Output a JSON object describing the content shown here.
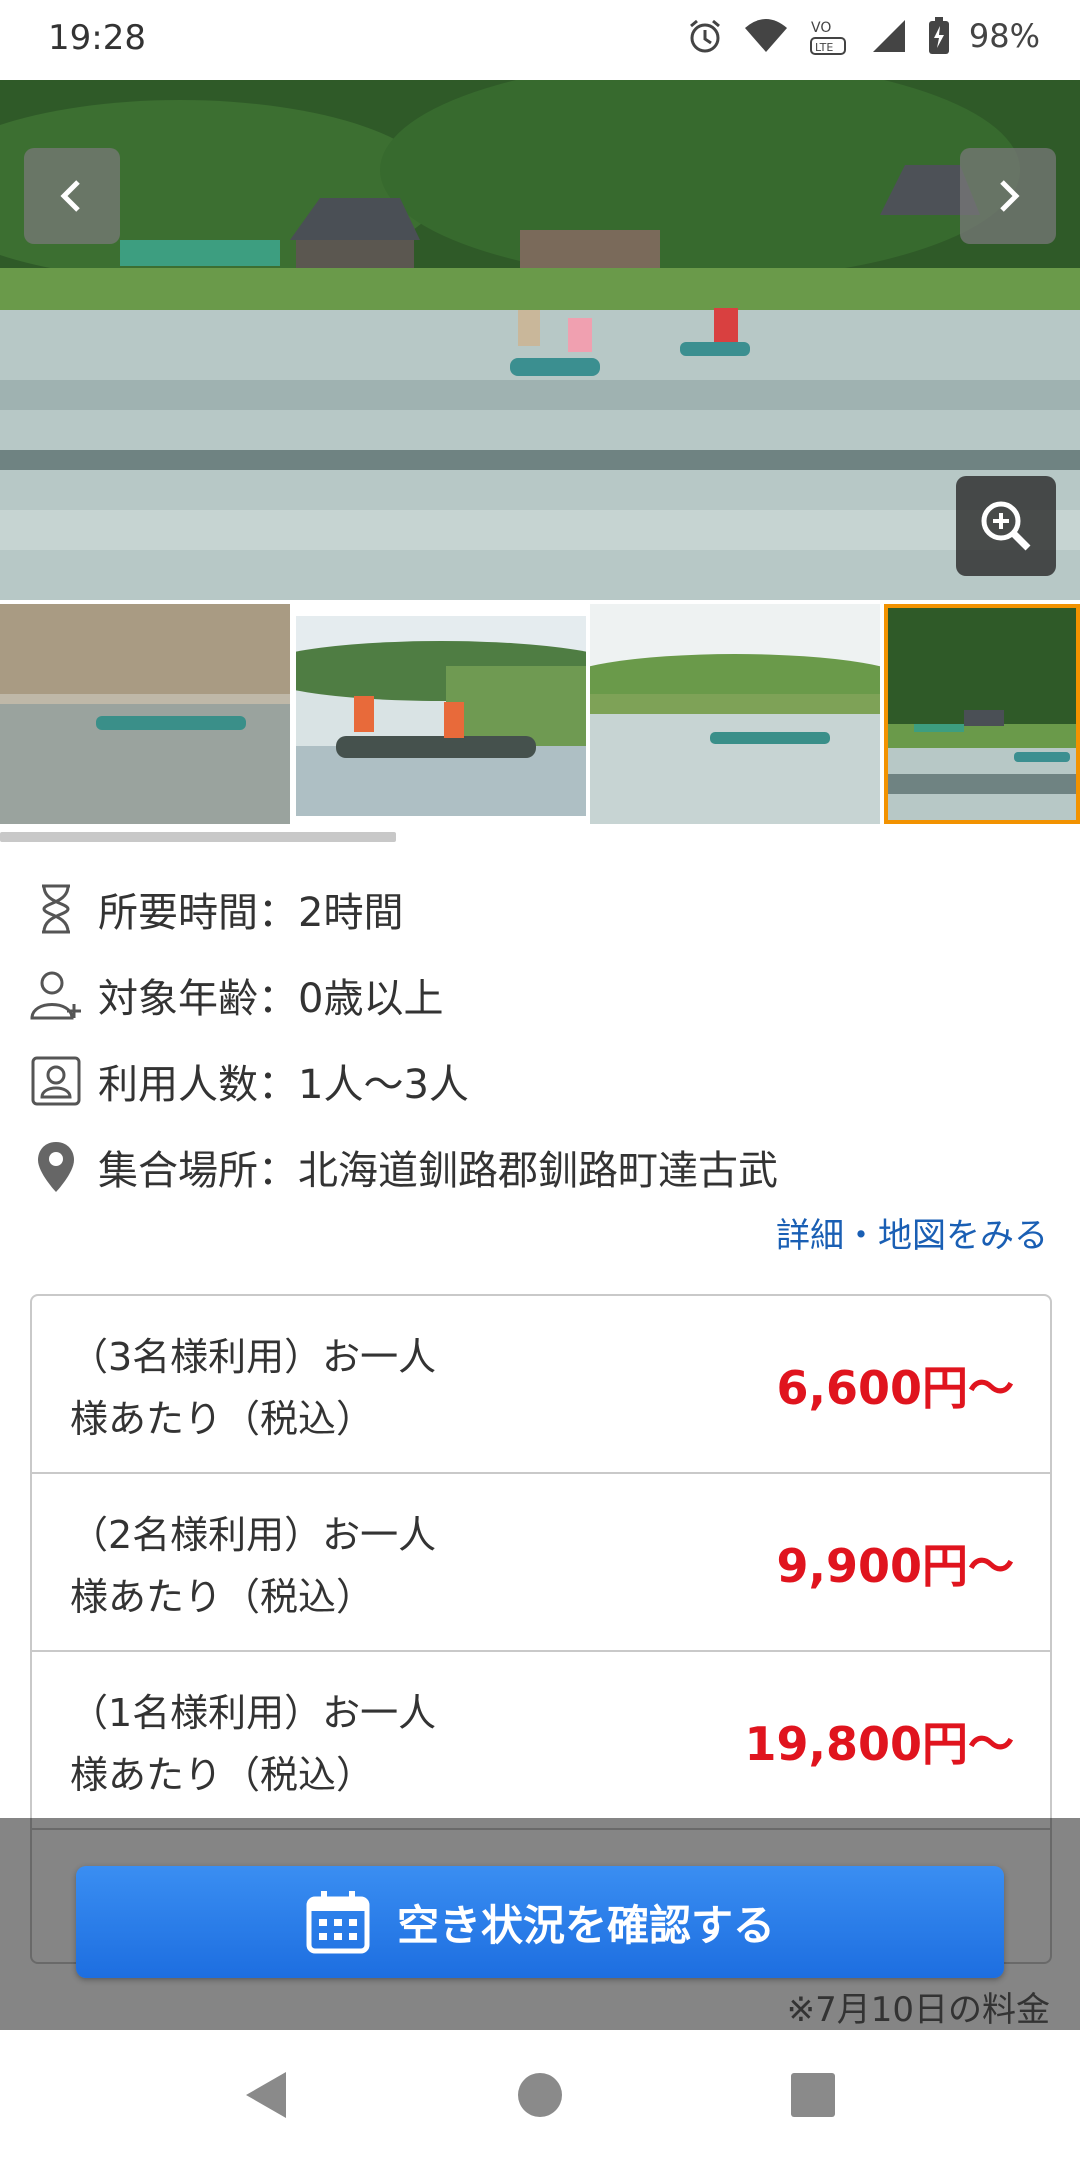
{
  "status_bar": {
    "time": "19:28",
    "battery_percent": "98%",
    "icons": [
      "alarm-icon",
      "wifi-icon",
      "volte-icon",
      "signal-icon",
      "battery-icon"
    ]
  },
  "gallery": {
    "thumbnails": [
      {
        "name": "thumbnail-1"
      },
      {
        "name": "thumbnail-2"
      },
      {
        "name": "thumbnail-3"
      },
      {
        "name": "thumbnail-4",
        "selected": true
      }
    ],
    "scroll_position_fraction": 0.37
  },
  "info": {
    "duration": "所要時間：2時間",
    "age": "対象年齢：0歳以上",
    "capacity": "利用人数：1人〜3人",
    "meeting_place": "集合場所：北海道釧路郡釧路町達古武",
    "map_link": "詳細・地図をみる"
  },
  "prices": [
    {
      "line1": "（3名様利用）お一人",
      "line2": "様あたり（税込）",
      "price": "6,600円〜"
    },
    {
      "line1": "（2名様利用）お一人",
      "line2": "様あたり（税込）",
      "price": "9,900円〜"
    },
    {
      "line1": "（1名様利用）お一人",
      "line2": "様あたり（税込）",
      "price": "19,800円〜"
    }
  ],
  "cta": {
    "label": "空き状況を確認する"
  },
  "footnote": "※7月10日の料金",
  "colors": {
    "accent_blue": "#1d6ee0",
    "price_red": "#e0141e",
    "selected_orange": "#f29200",
    "link_blue": "#1a5fb4"
  }
}
